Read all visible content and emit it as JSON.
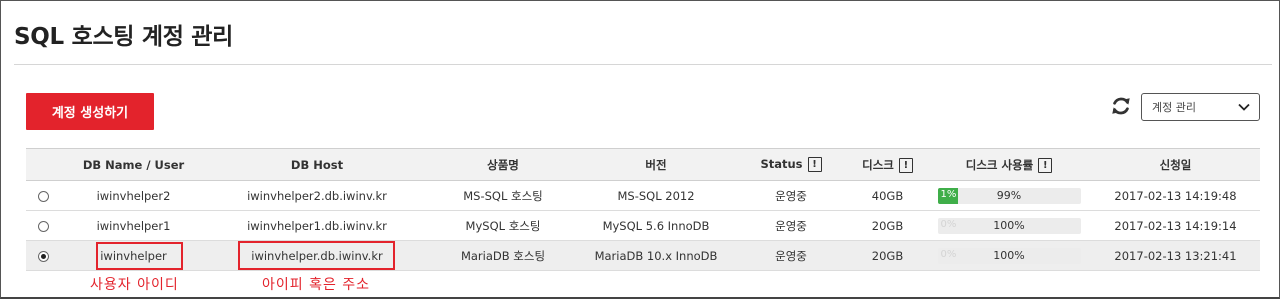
{
  "page": {
    "title": "SQL 호스팅 계정 관리"
  },
  "toolbar": {
    "create_label": "계정 생성하기",
    "refresh_icon": "refresh-icon",
    "select_value": "계정 관리",
    "select_icon": "chevron-down-icon"
  },
  "table": {
    "headers": {
      "name": "DB Name / User",
      "host": "DB Host",
      "product": "상품명",
      "version": "버전",
      "status": "Status",
      "disk": "디스크",
      "usage": "디스크 사용률",
      "date": "신청일",
      "info_glyph": "!"
    },
    "rows": [
      {
        "selected": false,
        "name": "iwinvhelper2",
        "host": "iwinvhelper2.db.iwinv.kr",
        "product": "MS-SQL 호스팅",
        "version": "MS-SQL 2012",
        "status": "운영중",
        "disk": "40GB",
        "usage_pct": "1%",
        "usage_fraction": 0.01,
        "usage_label": "99%",
        "date": "2017-02-13 14:19:48"
      },
      {
        "selected": false,
        "name": "iwinvhelper1",
        "host": "iwinvhelper1.db.iwinv.kr",
        "product": "MySQL 호스팅",
        "version": "MySQL 5.6 InnoDB",
        "status": "운영중",
        "disk": "20GB",
        "usage_pct": "0%",
        "usage_fraction": 0,
        "usage_label": "100%",
        "date": "2017-02-13 14:19:14"
      },
      {
        "selected": true,
        "name": "iwinvhelper",
        "host": "iwinvhelper.db.iwinv.kr",
        "product": "MariaDB 호스팅",
        "version": "MariaDB 10.x InnoDB",
        "status": "운영중",
        "disk": "20GB",
        "usage_pct": "0%",
        "usage_fraction": 0,
        "usage_label": "100%",
        "date": "2017-02-13 13:21:41"
      }
    ]
  },
  "annotations": {
    "user_id": "사용자 아이디",
    "ip_or_address": "아이피 혹은 주소",
    "color": "#e3232c"
  },
  "colors": {
    "accent": "#e3232c",
    "progress": "#3fae49"
  }
}
